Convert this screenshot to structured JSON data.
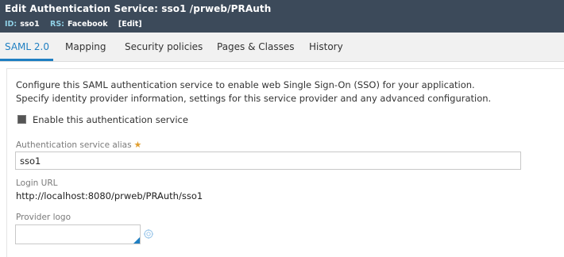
{
  "header": {
    "title": "Edit  Authentication Service: sso1 /prweb/PRAuth",
    "id_key": "ID:",
    "id_value": "sso1",
    "rs_key": "RS:",
    "rs_value": "Facebook",
    "edit_label": "[Edit]"
  },
  "tabs": [
    {
      "label": "SAML 2.0",
      "active": true
    },
    {
      "label": "Mapping",
      "active": false
    },
    {
      "label": "Security policies",
      "active": false
    },
    {
      "label": "Pages & Classes",
      "active": false
    },
    {
      "label": "History",
      "active": false
    }
  ],
  "content": {
    "description_line1": "Configure this SAML authentication service to enable web Single Sign-On (SSO) for your application.",
    "description_line2": "Specify identity provider information, settings for this service provider and any advanced configuration.",
    "enable_checkbox": {
      "label": "Enable this authentication service",
      "checked": true
    },
    "alias_field": {
      "label": "Authentication service alias",
      "required_marker": "★",
      "value": "sso1"
    },
    "login_url": {
      "label": "Login URL",
      "value": "http://localhost:8080/prweb/PRAuth/sso1"
    },
    "provider_logo": {
      "label": "Provider logo"
    }
  },
  "icons": {
    "target": "target-icon",
    "corner": "resize-corner-icon"
  },
  "colors": {
    "header_bg": "#3c4a5a",
    "accent": "#1f7fc2",
    "required": "#e19f30"
  }
}
